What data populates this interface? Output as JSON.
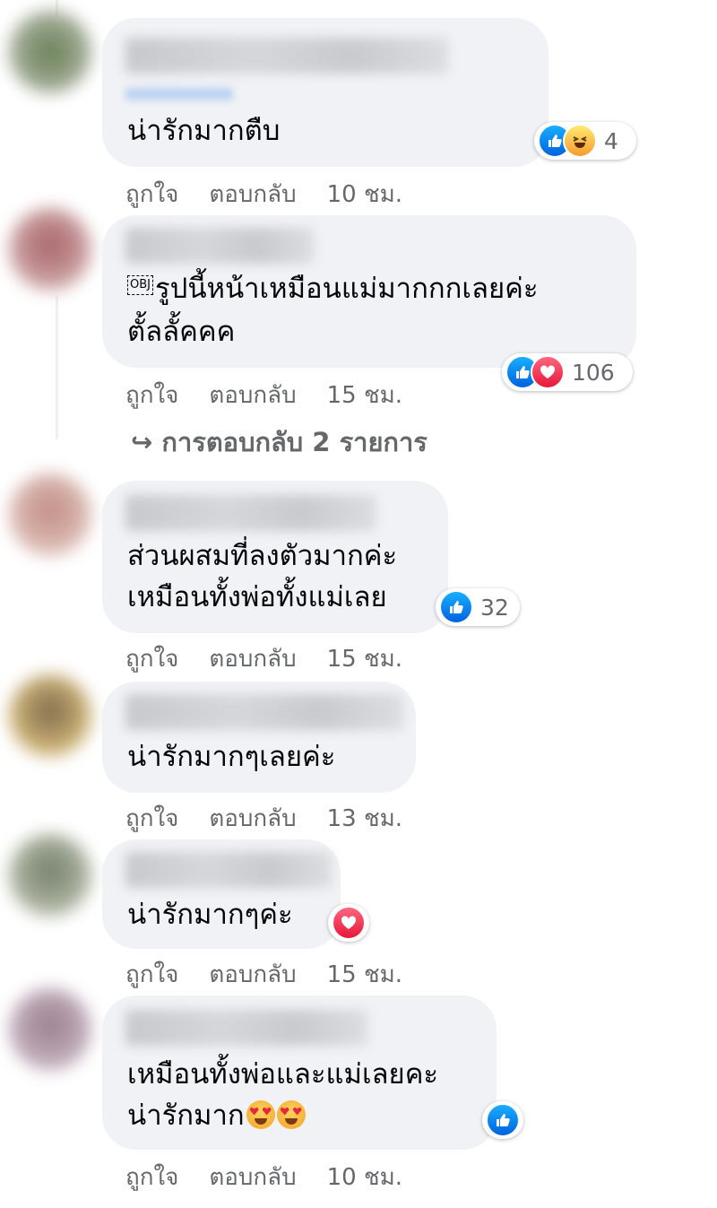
{
  "comments": [
    {
      "text_lines": [
        "น่ารักมากตืบ"
      ],
      "reactions": [
        "like",
        "haha"
      ],
      "reaction_count": "4",
      "like_label": "ถูกใจ",
      "reply_label": "ตอบกลับ",
      "time": "10 ชม."
    },
    {
      "text_lines": [
        "รูปนี้หน้าเหมือนแม่มากกกเลยค่ะ",
        "ตั้ลลั้คคค"
      ],
      "prefix_glyph": "OBJ",
      "reactions": [
        "like",
        "love"
      ],
      "reaction_count": "106",
      "like_label": "ถูกใจ",
      "reply_label": "ตอบกลับ",
      "time": "15 ชม."
    },
    {
      "text_lines": [
        "ส่วนผสมที่ลงตัวมากค่ะ",
        "เหมือนทั้งพ่อทั้งแม่เลย"
      ],
      "reactions": [
        "like"
      ],
      "reaction_count": "32",
      "like_label": "ถูกใจ",
      "reply_label": "ตอบกลับ",
      "time": "15 ชม."
    },
    {
      "text_lines": [
        "น่ารักมากๆเลยค่ะ"
      ],
      "reactions": [],
      "like_label": "ถูกใจ",
      "reply_label": "ตอบกลับ",
      "time": "13 ชม."
    },
    {
      "text_lines": [
        "น่ารักมากๆค่ะ"
      ],
      "reactions": [
        "love"
      ],
      "like_label": "ถูกใจ",
      "reply_label": "ตอบกลับ",
      "time": "15 ชม."
    },
    {
      "text_lines": [
        "เหมือนทั้งพ่อและแม่เลยคะ",
        "น่ารักมาก"
      ],
      "trailing_emoji": "heart-eyes x2",
      "reactions": [
        "like"
      ],
      "like_label": "ถูกใจ",
      "reply_label": "ตอบกลับ",
      "time": "10 ชม."
    }
  ],
  "replies_link": "↪ การตอบกลับ 2 รายการ",
  "colors": {
    "bubble": "#f0f2f5",
    "meta_text": "#65676b",
    "like_blue": "#1877f2",
    "love_red": "#f33e58"
  }
}
